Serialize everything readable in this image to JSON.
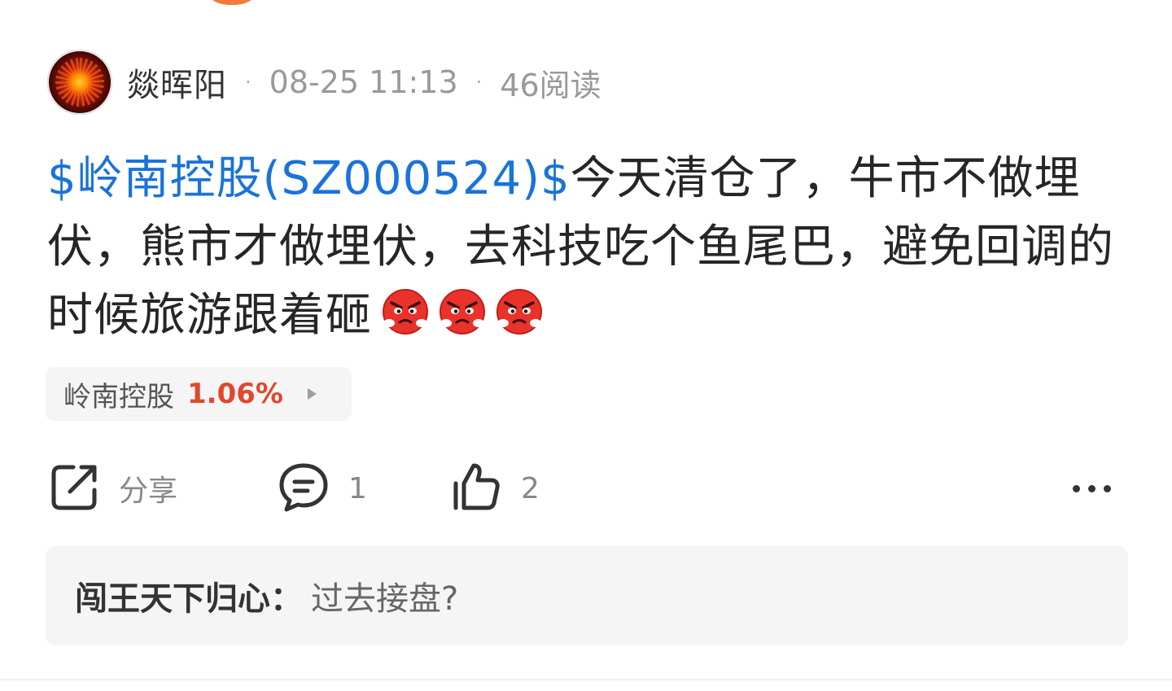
{
  "post": {
    "author": "燚晖阳",
    "time": "08-25 11:13",
    "reads": "46阅读",
    "separator": "·",
    "stock_link": "$岭南控股(SZ000524)$",
    "body": "今天清仓了，牛市不做埋伏，熊市才做埋伏，去科技吃个鱼尾巴，避免回调的时候旅游跟着砸",
    "emoji": [
      "angry-face-icon",
      "angry-face-icon",
      "angry-face-icon"
    ]
  },
  "stock_chip": {
    "name": "岭南控股",
    "change": "1.06%",
    "change_color": "#e0482c"
  },
  "actions": {
    "share_label": "分享",
    "comment_count": "1",
    "like_count": "2"
  },
  "comment_preview": {
    "author": "闯王天下归心",
    "colon": "：",
    "text": "过去接盘?"
  },
  "colors": {
    "link": "#1a73d9",
    "text": "#262626",
    "muted": "#999999"
  }
}
